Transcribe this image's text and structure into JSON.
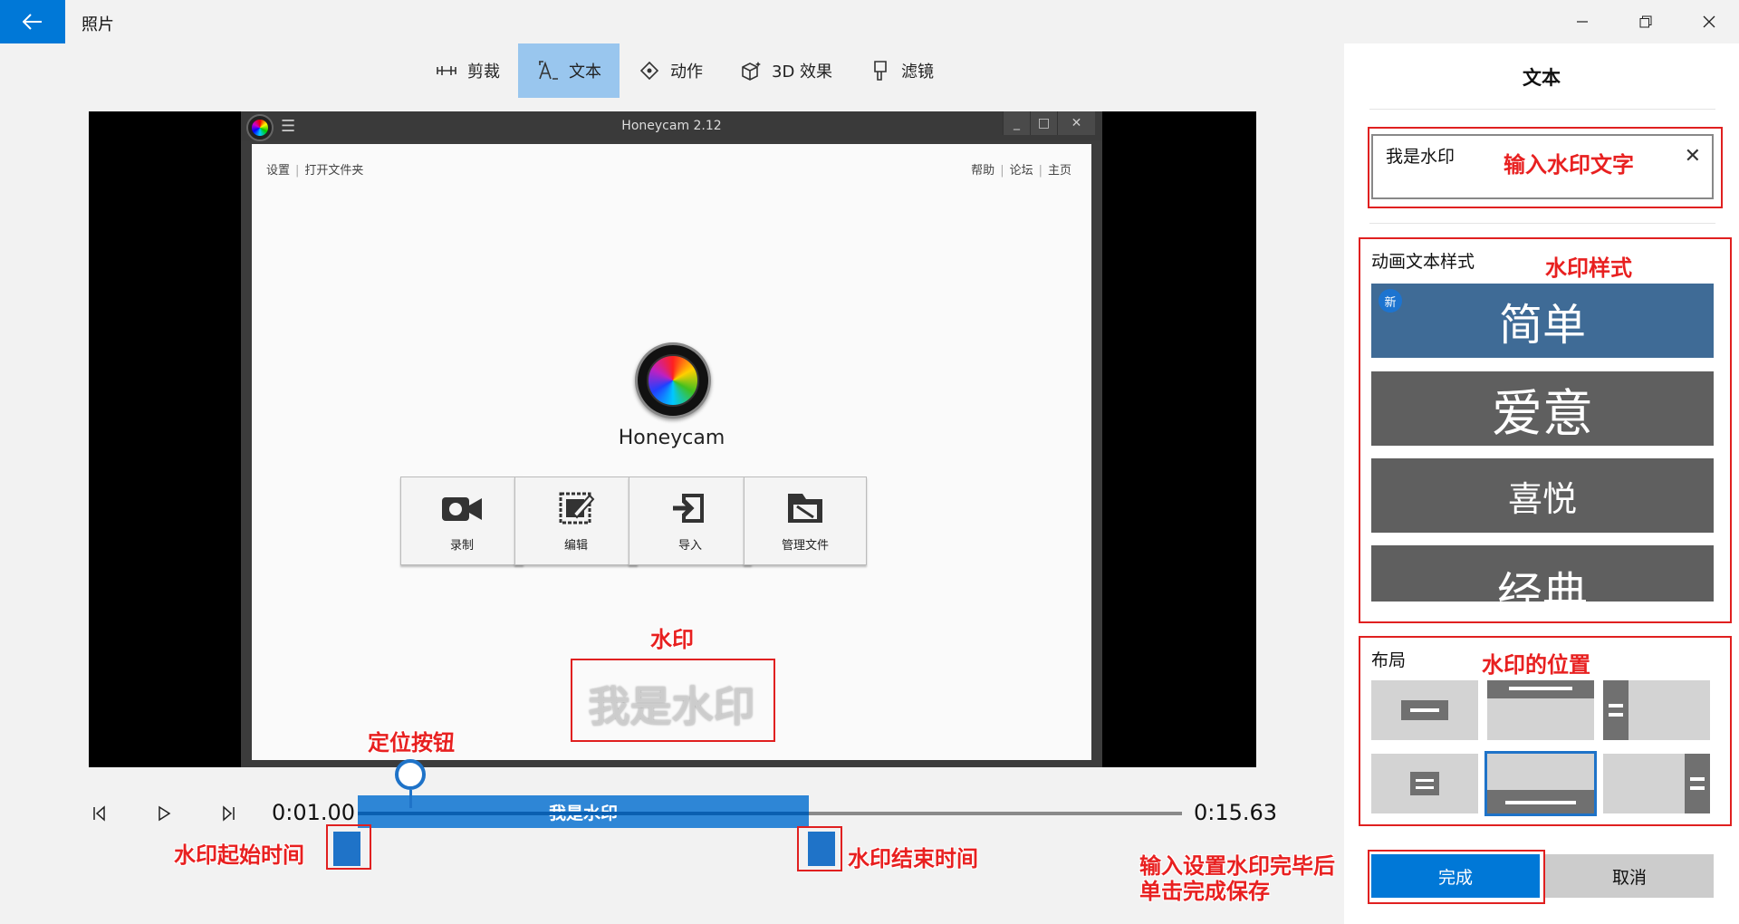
{
  "app": {
    "title": "照片"
  },
  "toolbar": {
    "items": [
      {
        "label": "剪裁"
      },
      {
        "label": "文本"
      },
      {
        "label": "动作"
      },
      {
        "label": "3D 效果"
      },
      {
        "label": "滤镜"
      }
    ]
  },
  "preview": {
    "honeycam": {
      "window_title": "Honeycam 2.12",
      "nav_left": [
        "设置",
        "打开文件夹"
      ],
      "nav_right": [
        "帮助",
        "论坛",
        "主页"
      ],
      "app_name": "Honeycam",
      "buttons": [
        {
          "label": "录制",
          "icon": "camera-icon"
        },
        {
          "label": "编辑",
          "icon": "edit-icon"
        },
        {
          "label": "导入",
          "icon": "import-icon"
        },
        {
          "label": "管理文件",
          "icon": "folder-icon"
        }
      ]
    },
    "watermark_text": "我是水印"
  },
  "playback": {
    "current_time": "0:01.00",
    "total_time": "0:15.63",
    "clip_label": "我是水印"
  },
  "panel": {
    "title": "文本",
    "text_value": "我是水印",
    "style_label": "动画文本样式",
    "styles": [
      {
        "label": "简单",
        "badge": "新"
      },
      {
        "label": "爱意"
      },
      {
        "label": "喜悦"
      },
      {
        "label": "经典"
      }
    ],
    "layout_label": "布局",
    "done_label": "完成",
    "cancel_label": "取消"
  },
  "annotations": {
    "input_text": "输入水印文字",
    "style": "水印样式",
    "position": "水印的位置",
    "watermark": "水印",
    "locator": "定位按钮",
    "start_time": "水印起始时间",
    "end_time": "水印结束时间",
    "save_line1": "输入设置水印完毕后",
    "save_line2": "单击完成保存"
  },
  "colors": {
    "accent": "#0078d7",
    "annotation": "#e02020",
    "selected_style": "#3f6b96"
  }
}
